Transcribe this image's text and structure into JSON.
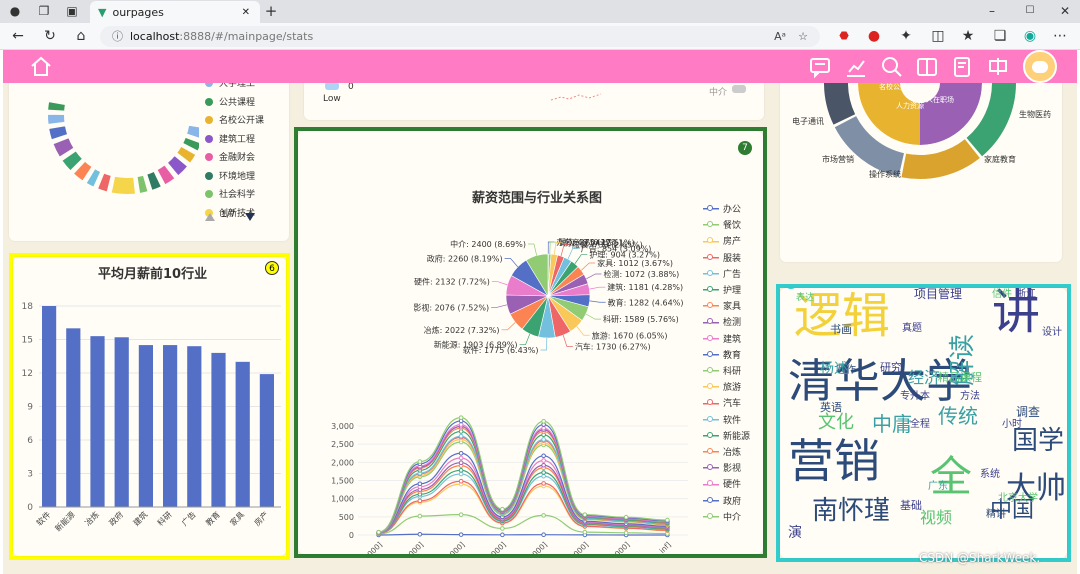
{
  "browser": {
    "tab_title": "ourpages",
    "new_tab": "+",
    "url_host": "localhost",
    "url_rest": ":8888/#/mainpage/stats",
    "read_aloud": "Aᵃ"
  },
  "colors": {
    "pink_bar": "#ff7bc4",
    "content_bg": "#f5efe0",
    "card_bg": "#fffdf5",
    "bar_blue": "#5470c6",
    "highlight_yellow": "#ffff00",
    "highlight_green": "#2e7d32",
    "highlight_cyan": "#33cccc"
  },
  "nav_icons": [
    "home-icon",
    "message-icon",
    "chart-icon",
    "abc-search-icon",
    "book-icon",
    "edit-icon",
    "sound-icon",
    "avatar"
  ],
  "top_left_legend": {
    "items": [
      {
        "label": "大学理工",
        "color": "#8ab5e8"
      },
      {
        "label": "公共课程",
        "color": "#3a9a5b"
      },
      {
        "label": "名校公开课",
        "color": "#e8b32e"
      },
      {
        "label": "建筑工程",
        "color": "#8b58c9"
      },
      {
        "label": "金融财会",
        "color": "#e85ea5"
      },
      {
        "label": "环境地理",
        "color": "#2f7b63"
      },
      {
        "label": "社会科学",
        "color": "#7cc36c"
      },
      {
        "label": "创新技术",
        "color": "#f5d54a"
      }
    ],
    "pager": "1/7"
  },
  "top_mid": {
    "low_label": "Low",
    "low_value": "0",
    "mid_label": "中介"
  },
  "top_right": {
    "labels": [
      "电子通讯",
      "市场营销",
      "操作系统",
      "家庭教育",
      "生物医药"
    ],
    "inner_labels": [
      "名校公开课",
      "人力资源",
      "人在职场"
    ]
  },
  "card6": {
    "badge": "6",
    "title": "平均月薪前10行业",
    "chart_data": {
      "type": "bar",
      "categories": [
        "软件",
        "新能源",
        "冶炼",
        "政府",
        "建筑",
        "科研",
        "广告",
        "教育",
        "家具",
        "房产"
      ],
      "values": [
        18.0,
        16.0,
        15.3,
        15.2,
        14.5,
        14.5,
        14.4,
        13.8,
        13.0,
        11.9
      ],
      "ylim": [
        0,
        18
      ],
      "yticks": [
        0,
        3,
        6,
        9,
        12,
        15,
        18
      ]
    }
  },
  "card7": {
    "badge": "7",
    "title": "薪资范围与行业关系图",
    "chart_data": [
      {
        "type": "pie",
        "slices": [
          {
            "label": "办公: 48 (0.17%)",
            "value": 48,
            "color": "#5470c6"
          },
          {
            "label": "餐饮: 275 (1%)",
            "value": 275,
            "color": "#91cc75"
          },
          {
            "label": "房产: 694 (2.51%)",
            "value": 694,
            "color": "#fac858"
          },
          {
            "label": "服装: 733 (2.65%)",
            "value": 733,
            "color": "#ee6666"
          },
          {
            "label": "广告: 854 (3.09%)",
            "value": 854,
            "color": "#73c0de"
          },
          {
            "label": "护理: 904 (3.27%)",
            "value": 904,
            "color": "#3ba272"
          },
          {
            "label": "家具: 1012 (3.67%)",
            "value": 1012,
            "color": "#fc8452"
          },
          {
            "label": "检测: 1072 (3.88%)",
            "value": 1072,
            "color": "#9a60b4"
          },
          {
            "label": "建筑: 1181 (4.28%)",
            "value": 1181,
            "color": "#ea7ccc"
          },
          {
            "label": "教育: 1282 (4.64%)",
            "value": 1282,
            "color": "#5470c6"
          },
          {
            "label": "科研: 1589 (5.76%)",
            "value": 1589,
            "color": "#91cc75"
          },
          {
            "label": "旅游: 1670 (6.05%)",
            "value": 1670,
            "color": "#fac858"
          },
          {
            "label": "汽车: 1730 (6.27%)",
            "value": 1730,
            "color": "#ee6666"
          },
          {
            "label": "软件: 1775 (6.43%)",
            "value": 1775,
            "color": "#73c0de"
          },
          {
            "label": "新能源: 1903 (6.89%)",
            "value": 1903,
            "color": "#3ba272"
          },
          {
            "label": "冶炼: 2022 (7.32%)",
            "value": 2022,
            "color": "#fc8452"
          },
          {
            "label": "影视: 2076 (7.52%)",
            "value": 2076,
            "color": "#9a60b4"
          },
          {
            "label": "硬件: 2132 (7.72%)",
            "value": 2132,
            "color": "#ea7ccc"
          },
          {
            "label": "政府: 2260 (8.19%)",
            "value": 2260,
            "color": "#5470c6"
          },
          {
            "label": "中介: 2400 (8.69%)",
            "value": 2400,
            "color": "#91cc75"
          }
        ]
      },
      {
        "type": "line",
        "categories": [
          "(0, 3000]",
          "(3001, 6000]",
          "(6001, 9000]",
          "(9001, 10000]",
          "(10001, 15000]",
          "(15001, 20000]",
          "(20001, 30000]",
          "(30001, inf]"
        ],
        "ylim": [
          0,
          3000
        ],
        "yticks": [
          "0",
          "500",
          "1,000",
          "1,500",
          "2,000",
          "2,500",
          "3,000"
        ],
        "series": [
          {
            "name": "办公",
            "values": [
              0,
              20,
              10,
              5,
              8,
              3,
              1,
              1
            ]
          },
          {
            "name": "餐饮",
            "values": [
              30,
              520,
              560,
              180,
              540,
              80,
              60,
              40
            ]
          },
          {
            "name": "房产",
            "values": [
              40,
              900,
              1400,
              320,
              1350,
              230,
              180,
              120
            ]
          },
          {
            "name": "服装",
            "values": [
              45,
              940,
              1480,
              330,
              1420,
              240,
              190,
              130
            ]
          },
          {
            "name": "广告",
            "values": [
              50,
              1060,
              1680,
              370,
              1620,
              280,
              220,
              160
            ]
          },
          {
            "name": "护理",
            "values": [
              52,
              1120,
              1780,
              390,
              1720,
              300,
              240,
              170
            ]
          },
          {
            "name": "家具",
            "values": [
              55,
              1200,
              1910,
              420,
              1850,
              320,
              260,
              190
            ]
          },
          {
            "name": "检测",
            "values": [
              58,
              1250,
              1990,
              440,
              1920,
              340,
              270,
              200
            ]
          },
          {
            "name": "建筑",
            "values": [
              60,
              1330,
              2120,
              470,
              2050,
              360,
              290,
              220
            ]
          },
          {
            "name": "教育",
            "values": [
              62,
              1410,
              2250,
              500,
              2180,
              380,
              310,
              240
            ]
          },
          {
            "name": "科研",
            "values": [
              65,
              1600,
              2560,
              560,
              2480,
              430,
              360,
              280
            ]
          },
          {
            "name": "旅游",
            "values": [
              66,
              1640,
              2630,
              580,
              2540,
              440,
              370,
              290
            ]
          },
          {
            "name": "汽车",
            "values": [
              67,
              1680,
              2690,
              590,
              2600,
              450,
              380,
              300
            ]
          },
          {
            "name": "软件",
            "values": [
              68,
              1700,
              2720,
              600,
              2630,
              460,
              390,
              310
            ]
          },
          {
            "name": "新能源",
            "values": [
              70,
              1780,
              2850,
              630,
              2760,
              480,
              410,
              330
            ]
          },
          {
            "name": "冶炼",
            "values": [
              72,
              1840,
              2940,
              650,
              2850,
              500,
              430,
              350
            ]
          },
          {
            "name": "影视",
            "values": [
              73,
              1870,
              2990,
              660,
              2900,
              510,
              440,
              360
            ]
          },
          {
            "name": "硬件",
            "values": [
              74,
              1900,
              3040,
              670,
              2940,
              520,
              450,
              370
            ]
          },
          {
            "name": "政府",
            "values": [
              76,
              1960,
              3140,
              690,
              3040,
              540,
              470,
              390
            ]
          },
          {
            "name": "中介",
            "values": [
              78,
              2020,
              3230,
              710,
              3130,
              560,
              490,
              410
            ]
          }
        ]
      }
    ],
    "legend": [
      "办公",
      "餐饮",
      "房产",
      "服装",
      "广告",
      "护理",
      "家具",
      "检测",
      "建筑",
      "教育",
      "科研",
      "旅游",
      "汽车",
      "软件",
      "新能源",
      "冶炼",
      "影视",
      "硬件",
      "政府",
      "中介"
    ]
  },
  "card8": {
    "badge": "8",
    "words": [
      {
        "t": "逻辑",
        "c": "#f2d13a"
      },
      {
        "t": "讲",
        "c": "#3b3f8c"
      },
      {
        "t": "清华大学",
        "c": "#2c4a7a"
      },
      {
        "t": "营销",
        "c": "#2c4a7a"
      },
      {
        "t": "全",
        "c": "#58c472"
      },
      {
        "t": "大帅",
        "c": "#2c4a7a"
      },
      {
        "t": "国学",
        "c": "#2c4a7a"
      },
      {
        "t": "南怀瑾",
        "c": "#2c4a7a"
      },
      {
        "t": "中国",
        "c": "#2c4a7a"
      },
      {
        "t": "解读",
        "c": "#3aa0a5"
      },
      {
        "t": "传统",
        "c": "#3aa0a5"
      },
      {
        "t": "文化",
        "c": "#58c472"
      },
      {
        "t": "中庸",
        "c": "#3aa0a5"
      },
      {
        "t": "经济",
        "c": "#3aa0a5"
      },
      {
        "t": "视频",
        "c": "#58c472"
      },
      {
        "t": "项目管理",
        "c": "#3b3f8c"
      },
      {
        "t": "精品课程",
        "c": "#58c472"
      },
      {
        "t": "调查",
        "c": "#2c4a7a"
      },
      {
        "t": "方法",
        "c": "#3b3f8c"
      },
      {
        "t": "英语",
        "c": "#2c4a7a"
      },
      {
        "t": "书画",
        "c": "#2c4a7a"
      },
      {
        "t": "研究",
        "c": "#3b3f8c"
      },
      {
        "t": "基础",
        "c": "#3b3f8c"
      },
      {
        "t": "专升本",
        "c": "#3b3f8c"
      },
      {
        "t": "北京大学",
        "c": "#58c472"
      },
      {
        "t": "系统",
        "c": "#3b3f8c"
      },
      {
        "t": "全程",
        "c": "#3b3f8c"
      },
      {
        "t": "表达",
        "c": "#58c472"
      },
      {
        "t": "写作",
        "c": "#2c4a7a"
      },
      {
        "t": "浙江",
        "c": "#3b3f8c"
      },
      {
        "t": "信件",
        "c": "#58c472"
      },
      {
        "t": "真题",
        "c": "#3b3f8c"
      },
      {
        "t": "设计",
        "c": "#3b3f8c"
      },
      {
        "t": "小时",
        "c": "#3b3f8c"
      },
      {
        "t": "精讲",
        "c": "#2c4a7a"
      },
      {
        "t": "广东",
        "c": "#3aa0a5"
      },
      {
        "t": "演",
        "c": "#3b3f8c"
      },
      {
        "t": "杨述",
        "c": "#3aa0a5"
      }
    ]
  },
  "watermark": "CSDN @SharkWeek."
}
